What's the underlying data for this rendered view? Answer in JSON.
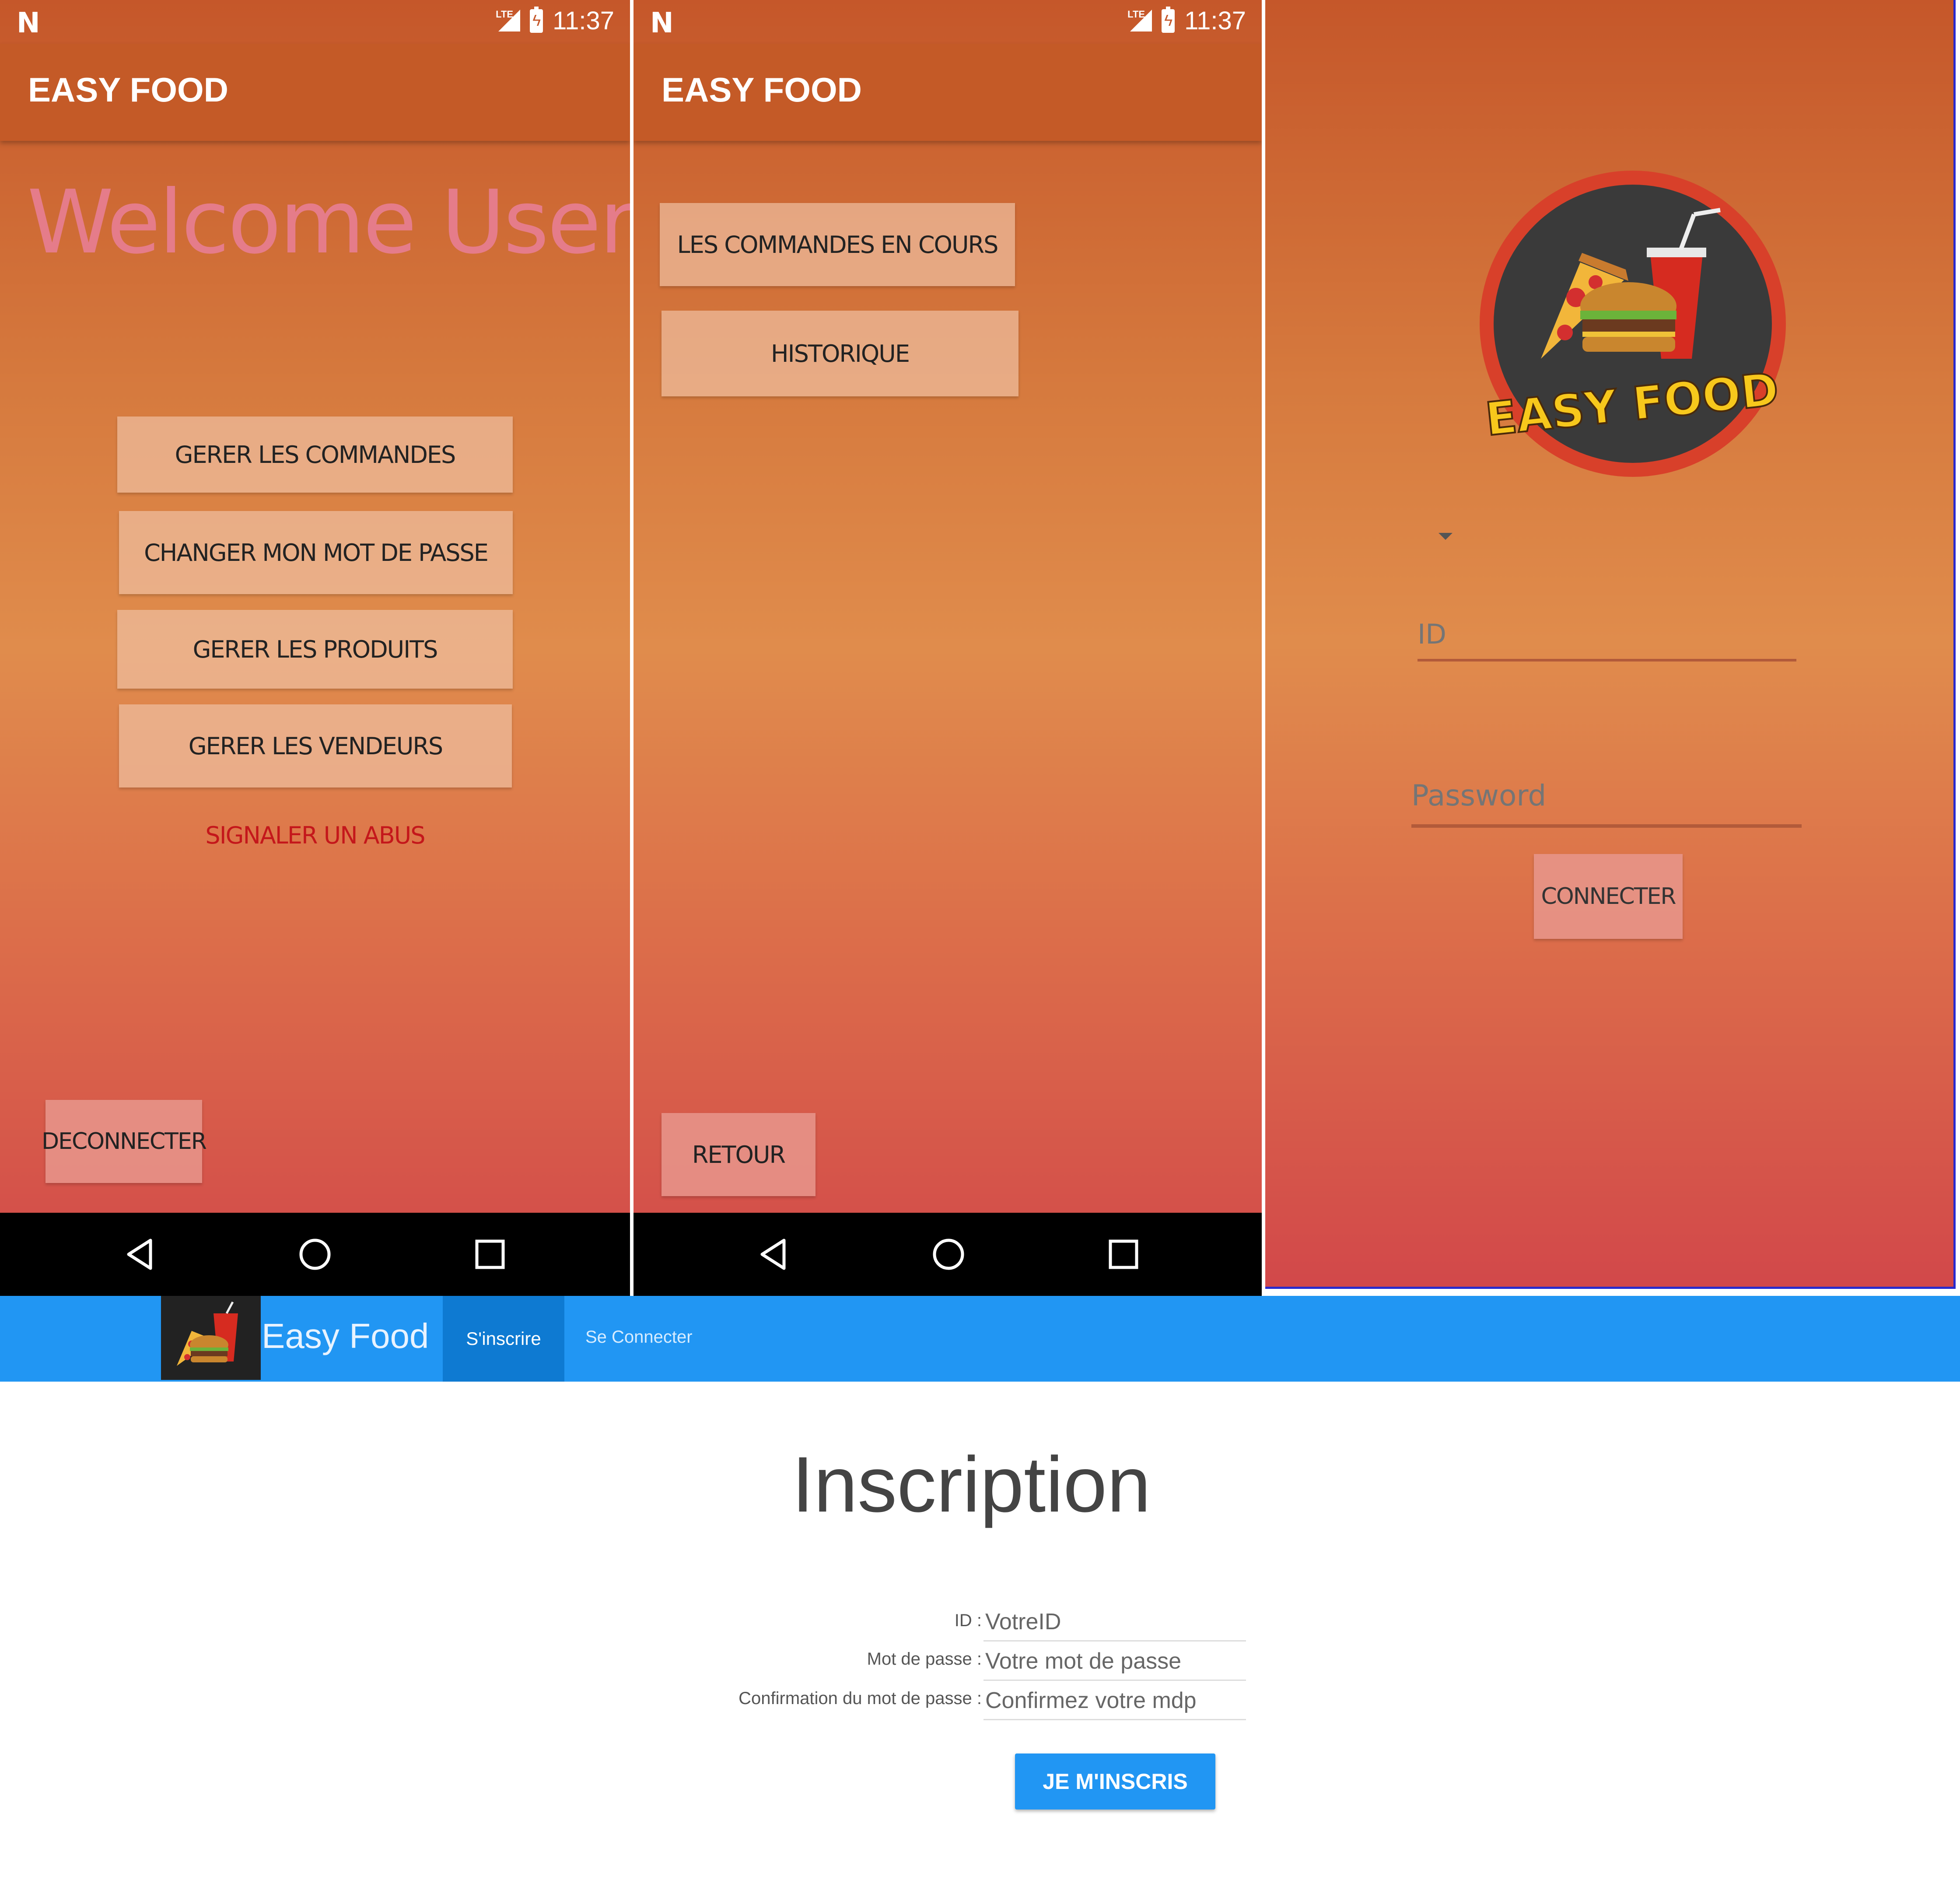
{
  "colors": {
    "app_bar": "#c45a27",
    "gradient_top": "#c5572a",
    "gradient_mid": "#e08c4c",
    "gradient_bottom": "#d2484a",
    "welcome_text": "#e57c8a",
    "abuse_link": "#c4171b",
    "web_nav": "#2196f3",
    "web_nav_active": "#0e7ad2"
  },
  "status_bar": {
    "time": "11:37",
    "network": "LTE"
  },
  "screen_admin": {
    "app_title": "EASY FOOD",
    "welcome": "Welcome User",
    "buttons": {
      "manage_orders": "GERER LES COMMANDES",
      "change_password": "CHANGER MON MOT DE PASSE",
      "manage_products": "GERER LES PRODUITS",
      "manage_sellers": "GERER LES VENDEURS"
    },
    "report_link": "SIGNALER UN ABUS",
    "logout": "DECONNECTER"
  },
  "screen_orders": {
    "app_title": "EASY FOOD",
    "buttons": {
      "current_orders": "LES COMMANDES EN COURS",
      "history": "HISTORIQUE",
      "back": "RETOUR"
    }
  },
  "screen_login": {
    "logo_text": "EASY FOOD",
    "id_placeholder": "ID",
    "password_placeholder": "Password",
    "connect": "CONNECTER"
  },
  "web": {
    "brand": "Easy Food",
    "nav": {
      "register": "S'inscrire",
      "login": "Se Connecter"
    },
    "title": "Inscription",
    "form": {
      "id_label": "ID :",
      "id_placeholder": "VotreID",
      "password_label": "Mot de passe :",
      "password_placeholder": "Votre mot de passe",
      "confirm_label": "Confirmation du mot de passe :",
      "confirm_placeholder": "Confirmez votre mdp",
      "submit": "JE M'INSCRIS"
    }
  }
}
